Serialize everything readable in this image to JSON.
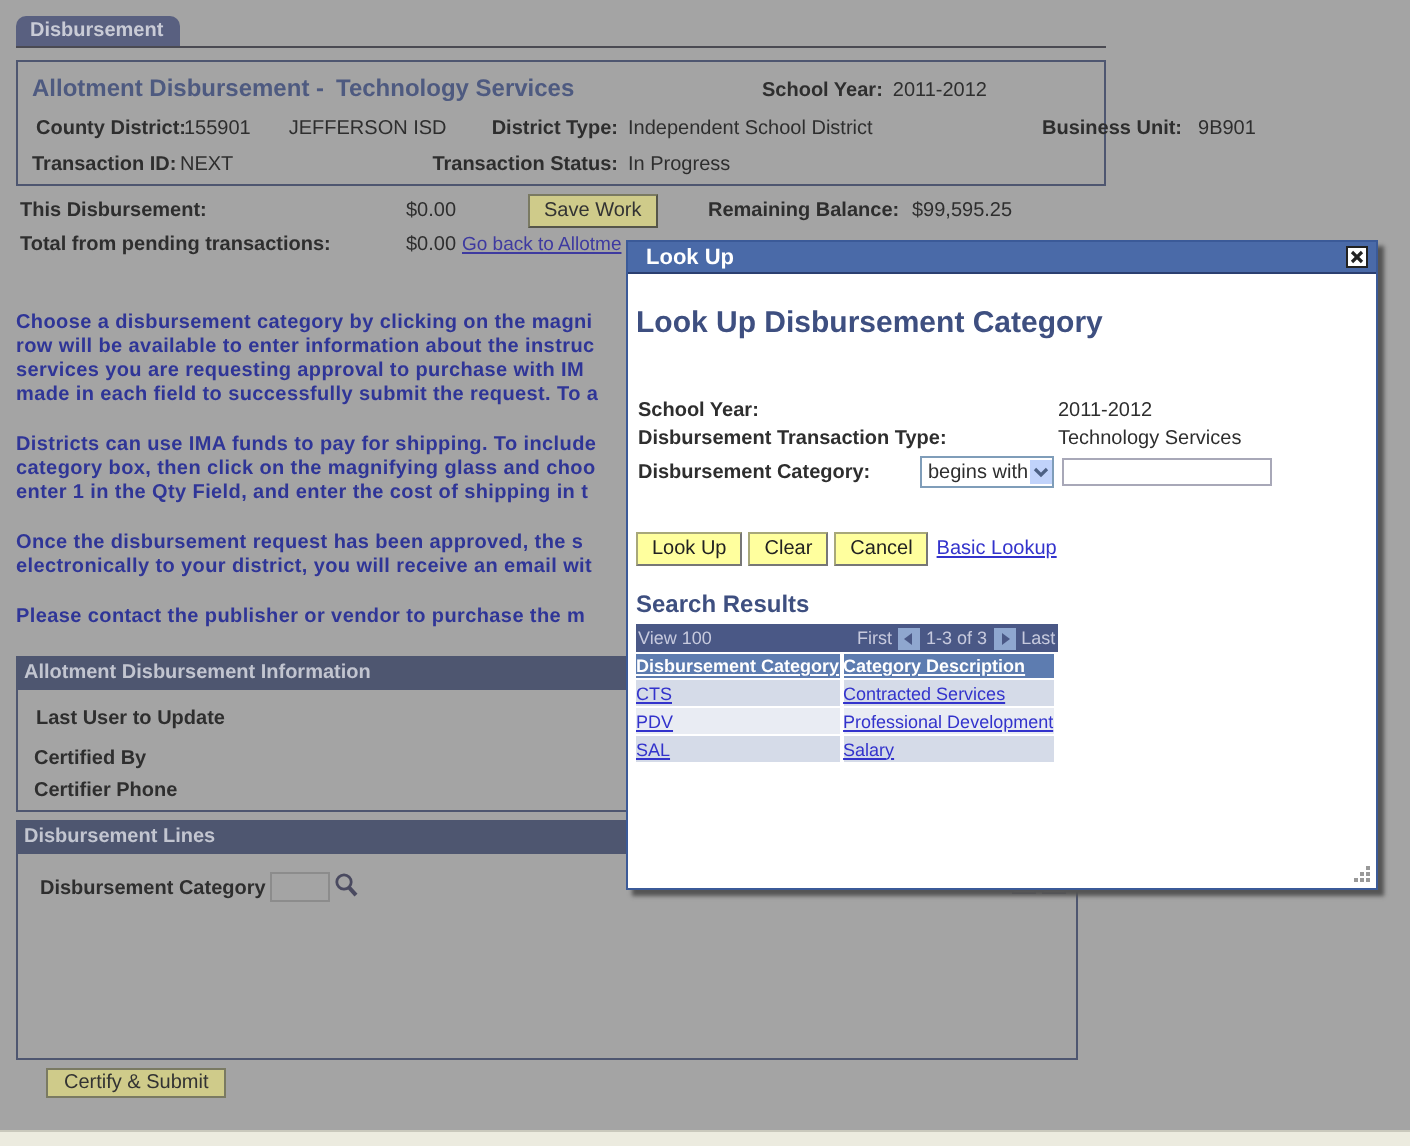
{
  "tab": {
    "label": "Disbursement",
    "selected": true
  },
  "header": {
    "title": "Allotment Disbursement -",
    "subtitle": "Technology Services",
    "school_year": {
      "label": "School Year:",
      "value": "2011-2012"
    },
    "rows": [
      [
        {
          "label": "County District:",
          "value": "155901",
          "extra": "JEFFERSON ISD"
        },
        {
          "label": "District Type:",
          "value": "Independent School District"
        },
        {
          "label": "Business Unit:",
          "value": "9B901"
        }
      ],
      [
        {
          "label": "Transaction ID:",
          "value": "NEXT"
        },
        {
          "label": "Transaction Status:",
          "value": "In Progress"
        }
      ]
    ]
  },
  "totals": {
    "this_label": "This Disbursement:",
    "this_value": "$0.00",
    "save_button": "Save Work",
    "remaining_label": "Remaining Balance:",
    "remaining_value": "$99,595.25",
    "pending_label": "Total from pending transactions:",
    "pending_value": "$0.00",
    "back_link": "Go back to Allotme"
  },
  "instructions": [
    [
      "Choose a disbursement category by clicking on the magni",
      "row will be available to enter information about the instruc",
      "services you are requesting approval to purchase with IM",
      "made in each field to successfully submit the request. To a"
    ],
    [
      "Districts can use IMA funds to pay for shipping. To include",
      "category box, then click on the magnifying glass and choo",
      "enter 1 in the Qty Field, and enter the cost of shipping in t"
    ],
    [
      "Once the disbursement request has been approved, the s",
      "electronically to your district, you will receive an email wit"
    ],
    [
      "Please contact the publisher or vendor to purchase the m"
    ]
  ],
  "info_section": {
    "title": "Allotment Disbursement Information",
    "fields": [
      "Last User to Update",
      "Certified By",
      "Certifier Phone"
    ]
  },
  "lines_section": {
    "title": "Disbursement Lines",
    "category_label": "Disbursement Category"
  },
  "submit_button": "Certify & Submit",
  "lookup": {
    "window_title": "Look Up",
    "heading": "Look Up Disbursement Category",
    "fields": [
      {
        "label": "School Year:",
        "value": "2011-2012"
      },
      {
        "label": "Disbursement Transaction Type:",
        "value": "Technology Services"
      }
    ],
    "category": {
      "label": "Disbursement Category:",
      "operator": "begins with"
    },
    "buttons": [
      "Look Up",
      "Clear",
      "Cancel"
    ],
    "basic_link": "Basic Lookup",
    "results_title": "Search Results",
    "grid": {
      "view": "View 100",
      "first": "First",
      "range": "1-3 of 3",
      "last": "Last",
      "columns": [
        "Disbursement Category",
        "Category Description"
      ],
      "rows": [
        [
          "CTS",
          "Contracted Services"
        ],
        [
          "PDV",
          "Professional Development"
        ],
        [
          "SAL",
          "Salary"
        ]
      ]
    }
  }
}
